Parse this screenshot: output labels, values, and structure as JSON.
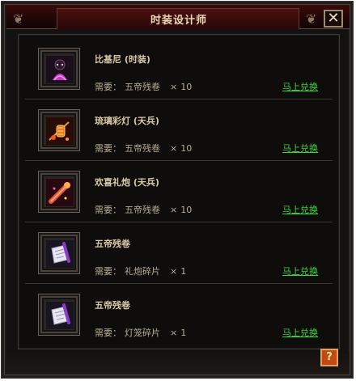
{
  "window": {
    "title": "时装设计师",
    "close_label": "✕"
  },
  "items": [
    {
      "name": "比基尼 (时装)",
      "req_label": "需要：",
      "material": "五帝残卷",
      "times": "×",
      "qty": "10",
      "action": "马上兑换",
      "icon": "bikini-costume-icon"
    },
    {
      "name": "琉璃彩灯 (天兵)",
      "req_label": "需要：",
      "material": "五帝残卷",
      "times": "×",
      "qty": "10",
      "action": "马上兑换",
      "icon": "glazed-lantern-icon"
    },
    {
      "name": "欢喜礼炮 (天兵)",
      "req_label": "需要：",
      "material": "五帝残卷",
      "times": "×",
      "qty": "10",
      "action": "马上兑换",
      "icon": "festive-cannon-icon"
    },
    {
      "name": "五帝残卷",
      "req_label": "需要：",
      "material": "礼炮碎片",
      "times": "×",
      "qty": "1",
      "action": "马上兑换",
      "icon": "scroll-icon"
    },
    {
      "name": "五帝残卷",
      "req_label": "需要：",
      "material": "灯笼碎片",
      "times": "×",
      "qty": "1",
      "action": "马上兑换",
      "icon": "scroll-icon"
    }
  ],
  "help": {
    "label": "?"
  },
  "colors": {
    "link": "#3fd43a",
    "title": "#e8d9b4",
    "help_bg": "#c24a12"
  }
}
